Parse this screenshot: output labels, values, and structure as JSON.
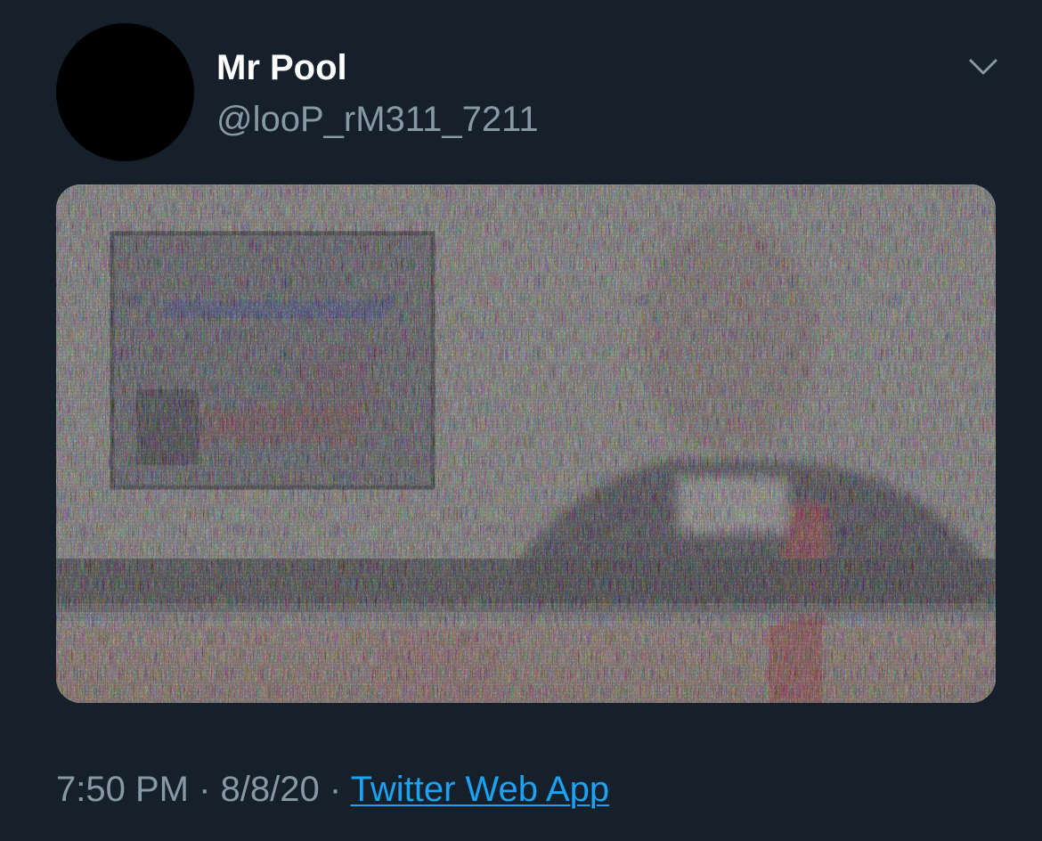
{
  "tweet": {
    "display_name": "Mr Pool",
    "handle": "@looP_rM311_7211",
    "time": "7:50 PM",
    "separator": "·",
    "date": "8/8/20",
    "source": "Twitter Web App"
  },
  "icons": {
    "menu": "chevron-down-icon"
  },
  "colors": {
    "background": "#15202b",
    "secondary_text": "#8899a6",
    "link": "#1da1f2",
    "avatar": "#000000"
  }
}
